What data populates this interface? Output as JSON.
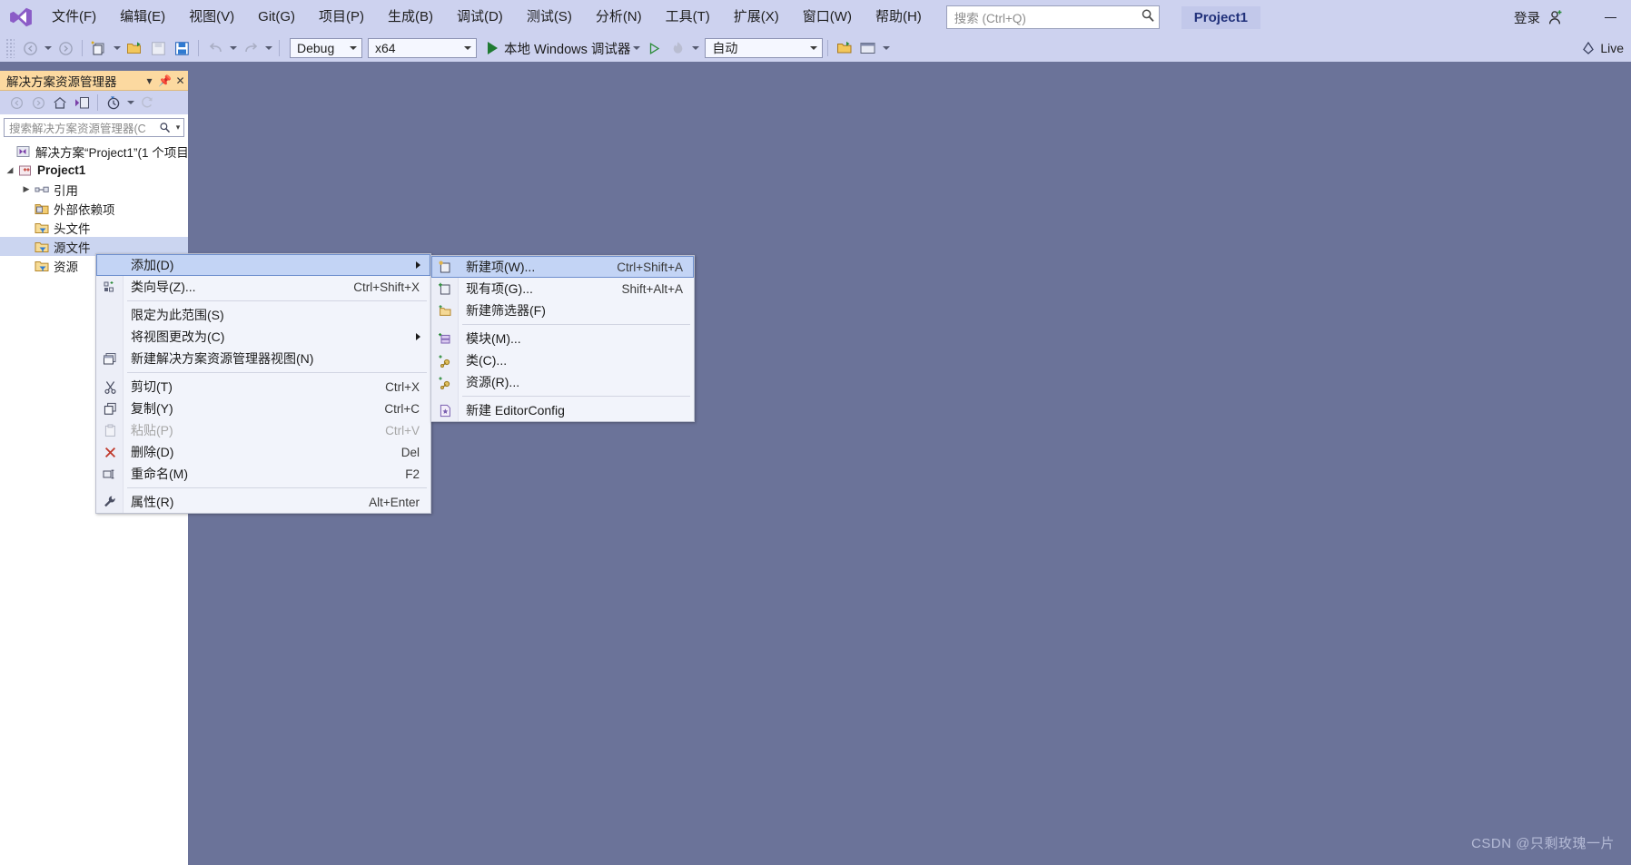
{
  "window": {
    "title_project": "Project1",
    "signin_label": "登录",
    "minimize_label": "—",
    "live_label": "Live"
  },
  "menubar": {
    "logo_icon": "visual-studio-logo-icon",
    "items": [
      {
        "label": "文件(F)"
      },
      {
        "label": "编辑(E)"
      },
      {
        "label": "视图(V)"
      },
      {
        "label": "Git(G)"
      },
      {
        "label": "项目(P)"
      },
      {
        "label": "生成(B)"
      },
      {
        "label": "调试(D)"
      },
      {
        "label": "测试(S)"
      },
      {
        "label": "分析(N)"
      },
      {
        "label": "工具(T)"
      },
      {
        "label": "扩展(X)"
      },
      {
        "label": "窗口(W)"
      },
      {
        "label": "帮助(H)"
      }
    ]
  },
  "search": {
    "placeholder": "搜索 (Ctrl+Q)",
    "icon": "search-icon",
    "value": ""
  },
  "toolbar": {
    "nav_back_icon": "navigate-back-icon",
    "nav_forward_icon": "navigate-forward-icon",
    "new_project_icon": "new-project-icon",
    "open_file_icon": "open-file-icon",
    "save_icon": "save-icon",
    "save_all_icon": "save-all-icon",
    "undo_icon": "undo-icon",
    "redo_icon": "redo-icon",
    "configuration": "Debug",
    "platform": "x64",
    "run_label": "本地 Windows 调试器",
    "run_icon": "play-icon",
    "start_without_debug_icon": "play-outline-icon",
    "hot_reload_icon": "hot-reload-icon",
    "auto_select": "自动",
    "live_share_icon": "live-share-icon"
  },
  "solution_explorer": {
    "title": "解决方案资源管理器",
    "title_dropdown_icon": "chevron-down-icon",
    "pin_icon": "pin-icon",
    "close_icon": "close-icon",
    "toolbar_icons": [
      "back-icon",
      "forward-icon",
      "home-icon",
      "sync-with-active-document-icon",
      "pending-changes-icon",
      "refresh-icon"
    ],
    "search": {
      "placeholder": "搜索解决方案资源管理器(C",
      "icon": "search-icon",
      "dropdown_icon": "chevron-down-icon"
    },
    "tree": [
      {
        "label": "解决方案“Project1”(1 个项目",
        "icon": "solution-icon",
        "indent": 0,
        "twisty": "",
        "bold": false,
        "selected": false
      },
      {
        "label": "Project1",
        "icon": "cpp-project-icon",
        "indent": 1,
        "twisty": "▲",
        "bold": true,
        "selected": false
      },
      {
        "label": "引用",
        "icon": "references-icon",
        "indent": 2,
        "twisty": "▶",
        "bold": false,
        "selected": false
      },
      {
        "label": "外部依赖项",
        "icon": "external-dependencies-icon",
        "indent": 2,
        "twisty": "",
        "bold": false,
        "selected": false
      },
      {
        "label": "头文件",
        "icon": "header-files-folder-icon",
        "indent": 2,
        "twisty": "",
        "bold": false,
        "selected": false
      },
      {
        "label": "源文件",
        "icon": "source-files-folder-icon",
        "indent": 2,
        "twisty": "",
        "bold": false,
        "selected": true
      },
      {
        "label": "资源",
        "icon": "resource-files-folder-icon",
        "indent": 2,
        "twisty": "",
        "bold": false,
        "selected": false
      }
    ]
  },
  "context_menu": {
    "items": [
      {
        "label": "添加(D)",
        "key": "",
        "icon": "",
        "submenu": true,
        "highlight": true,
        "disabled": false,
        "sep_after": false
      },
      {
        "label": "类向导(Z)...",
        "key": "Ctrl+Shift+X",
        "icon": "class-wizard-icon",
        "submenu": false,
        "highlight": false,
        "disabled": false,
        "sep_after": true
      },
      {
        "label": "限定为此范围(S)",
        "key": "",
        "icon": "",
        "submenu": false,
        "highlight": false,
        "disabled": false,
        "sep_after": false
      },
      {
        "label": "将视图更改为(C)",
        "key": "",
        "icon": "",
        "submenu": true,
        "highlight": false,
        "disabled": false,
        "sep_after": false
      },
      {
        "label": "新建解决方案资源管理器视图(N)",
        "key": "",
        "icon": "new-solution-explorer-view-icon",
        "submenu": false,
        "highlight": false,
        "disabled": false,
        "sep_after": true
      },
      {
        "label": "剪切(T)",
        "key": "Ctrl+X",
        "icon": "cut-icon",
        "submenu": false,
        "highlight": false,
        "disabled": false,
        "sep_after": false
      },
      {
        "label": "复制(Y)",
        "key": "Ctrl+C",
        "icon": "copy-icon",
        "submenu": false,
        "highlight": false,
        "disabled": false,
        "sep_after": false
      },
      {
        "label": "粘贴(P)",
        "key": "Ctrl+V",
        "icon": "paste-icon",
        "submenu": false,
        "highlight": false,
        "disabled": true,
        "sep_after": false
      },
      {
        "label": "删除(D)",
        "key": "Del",
        "icon": "delete-icon",
        "submenu": false,
        "highlight": false,
        "disabled": false,
        "sep_after": false
      },
      {
        "label": "重命名(M)",
        "key": "F2",
        "icon": "rename-icon",
        "submenu": false,
        "highlight": false,
        "disabled": false,
        "sep_after": true
      },
      {
        "label": "属性(R)",
        "key": "Alt+Enter",
        "icon": "properties-wrench-icon",
        "submenu": false,
        "highlight": false,
        "disabled": false,
        "sep_after": false
      }
    ]
  },
  "submenu": {
    "items": [
      {
        "label": "新建项(W)...",
        "key": "Ctrl+Shift+A",
        "icon": "new-item-icon",
        "highlight": true,
        "sep_after": false
      },
      {
        "label": "现有项(G)...",
        "key": "Shift+Alt+A",
        "icon": "existing-item-icon",
        "highlight": false,
        "sep_after": false
      },
      {
        "label": "新建筛选器(F)",
        "key": "",
        "icon": "new-filter-icon",
        "highlight": false,
        "sep_after": true
      },
      {
        "label": "模块(M)...",
        "key": "",
        "icon": "module-icon",
        "highlight": false,
        "sep_after": false
      },
      {
        "label": "类(C)...",
        "key": "",
        "icon": "class-icon",
        "highlight": false,
        "sep_after": false
      },
      {
        "label": "资源(R)...",
        "key": "",
        "icon": "resource-icon",
        "highlight": false,
        "sep_after": true
      },
      {
        "label": "新建 EditorConfig",
        "key": "",
        "icon": "editorconfig-icon",
        "highlight": false,
        "sep_after": false
      }
    ]
  },
  "watermark": {
    "text": "CSDN @只剩玫瑰一片"
  },
  "colors": {
    "titlebar_bg": "#cdd2ef",
    "workspace_bg": "#6b7399",
    "panel_title_bg": "#fcd9a0",
    "menu_bg": "#f2f4fb",
    "highlight": "#c3d4f5",
    "accent_purple": "#8b5cc7",
    "run_green": "#1f7a32"
  }
}
